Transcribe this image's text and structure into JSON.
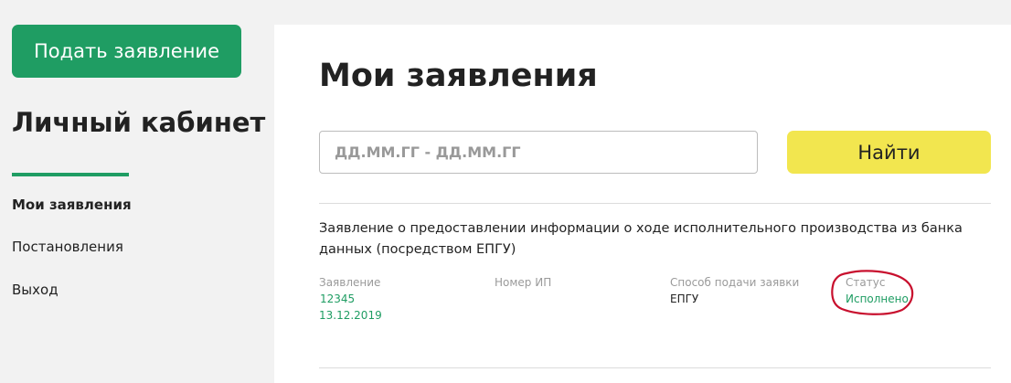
{
  "sidebar": {
    "apply_button": "Подать заявление",
    "title": "Личный кабинет",
    "nav": [
      {
        "label": "Мои заявления",
        "active": true
      },
      {
        "label": "Постановления",
        "active": false
      },
      {
        "label": "Выход",
        "active": false
      }
    ]
  },
  "main": {
    "title": "Мои заявления",
    "date_range_placeholder": "ДД.ММ.ГГ - ДД.ММ.ГГ",
    "search_button": "Найти",
    "application": {
      "title": "Заявление о предоставлении информации о ходе исполнительного производства из банка данных (посредством ЕПГУ)",
      "fields": {
        "application_label": "Заявление",
        "application_number": "12345",
        "application_date": "13.12.2019",
        "ip_number_label": "Номер ИП",
        "ip_number_value": "",
        "submission_method_label": "Способ подачи заявки",
        "submission_method_value": "ЕПГУ",
        "status_label": "Статус",
        "status_value": "Исполнено"
      }
    }
  },
  "colors": {
    "brand_green": "#1f9d63",
    "search_yellow": "#f2e64f",
    "annotation_red": "#c8102e"
  }
}
